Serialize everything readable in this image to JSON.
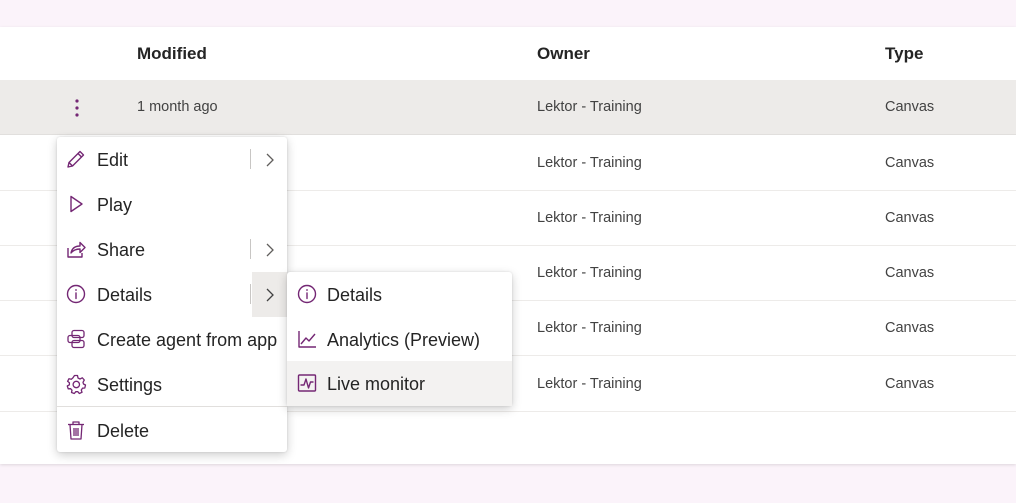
{
  "table": {
    "columns": {
      "modified": "Modified",
      "owner": "Owner",
      "type": "Type"
    },
    "rows": [
      {
        "modified": "1 month ago",
        "owner": "Lektor - Training",
        "type": "Canvas"
      },
      {
        "modified": "",
        "owner": "Lektor - Training",
        "type": "Canvas"
      },
      {
        "modified": "",
        "owner": "Lektor - Training",
        "type": "Canvas"
      },
      {
        "modified": "",
        "owner": "Lektor - Training",
        "type": "Canvas"
      },
      {
        "modified": "",
        "owner": "Lektor - Training",
        "type": "Canvas"
      },
      {
        "modified": "",
        "owner": "Lektor - Training",
        "type": "Canvas"
      }
    ]
  },
  "context_menu": {
    "items": [
      {
        "label": "Edit",
        "icon": "pencil-icon",
        "has_submenu": true
      },
      {
        "label": "Play",
        "icon": "play-icon",
        "has_submenu": false
      },
      {
        "label": "Share",
        "icon": "share-icon",
        "has_submenu": true
      },
      {
        "label": "Details",
        "icon": "info-icon",
        "has_submenu": true
      },
      {
        "label": "Create agent from app",
        "icon": "agent-icon",
        "has_submenu": false
      },
      {
        "label": "Settings",
        "icon": "gear-icon",
        "has_submenu": false
      },
      {
        "label": "Delete",
        "icon": "trash-icon",
        "has_submenu": false
      }
    ]
  },
  "details_submenu": {
    "items": [
      {
        "label": "Details",
        "icon": "info-icon"
      },
      {
        "label": "Analytics (Preview)",
        "icon": "analytics-icon"
      },
      {
        "label": "Live monitor",
        "icon": "live-monitor-icon"
      }
    ]
  },
  "colors": {
    "accent": "#742774",
    "page_background": "#fbf3fa",
    "selected_row": "#edebe9"
  }
}
